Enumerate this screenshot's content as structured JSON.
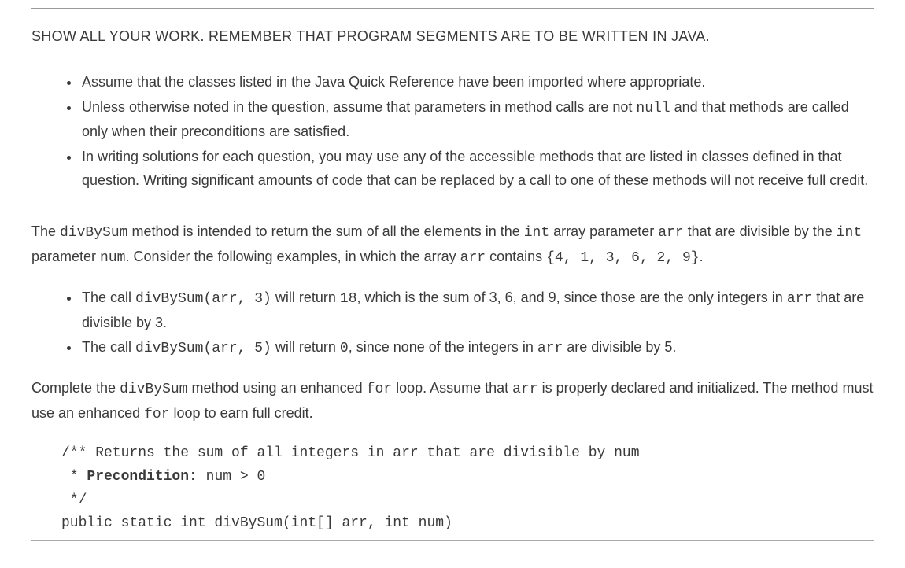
{
  "header": "SHOW ALL YOUR WORK. REMEMBER THAT PROGRAM SEGMENTS ARE TO BE WRITTEN IN JAVA.",
  "instructions": {
    "item1": "Assume that the classes listed in the Java Quick Reference have been imported where appropriate.",
    "item2_a": "Unless otherwise noted in the question, assume that parameters in method calls are not ",
    "item2_code": "null",
    "item2_b": " and that methods are called only when their preconditions are satisfied.",
    "item3": "In writing solutions for each question, you may use any of the accessible methods that are listed in classes defined in that question. Writing significant amounts of code that can be replaced by a call to one of these methods will not receive full credit."
  },
  "intro": {
    "a": "The ",
    "c1": "divBySum",
    "b": " method is intended to return the sum of all the elements in the ",
    "c2": "int",
    "c": " array parameter ",
    "c3": "arr",
    "d": " that are divisible by the ",
    "c4": "int",
    "e": " parameter ",
    "c5": "num",
    "f": ". Consider the following examples, in which the array ",
    "c6": "arr",
    "g": " contains ",
    "c7": "{4, 1, 3, 6, 2, 9}",
    "h": "."
  },
  "examples": {
    "ex1_a": "The call ",
    "ex1_code1": "divBySum(arr, 3)",
    "ex1_b": " will return ",
    "ex1_code2": "18",
    "ex1_c": ", which is the sum of 3, 6, and 9, since those are the only integers in ",
    "ex1_code3": "arr",
    "ex1_d": " that are divisible by 3.",
    "ex2_a": "The call ",
    "ex2_code1": "divBySum(arr, 5)",
    "ex2_b": " will return ",
    "ex2_code2": "0",
    "ex2_c": ", since none of the integers in ",
    "ex2_code3": "arr",
    "ex2_d": " are divisible by 5."
  },
  "task": {
    "a": "Complete the ",
    "c1": "divBySum",
    "b": " method using an enhanced ",
    "c2": "for",
    "c": " loop. Assume that ",
    "c3": "arr",
    "d": " is properly declared and initialized. The method must use an enhanced ",
    "c4": "for",
    "e": " loop to earn full credit."
  },
  "code": {
    "line1": "/** Returns the sum of all integers in arr that are divisible by num",
    "line2_a": " * ",
    "line2_bold": "Precondition:",
    "line2_b": " num > 0",
    "line3": " */",
    "line4": "public static int divBySum(int[] arr, int num)"
  }
}
